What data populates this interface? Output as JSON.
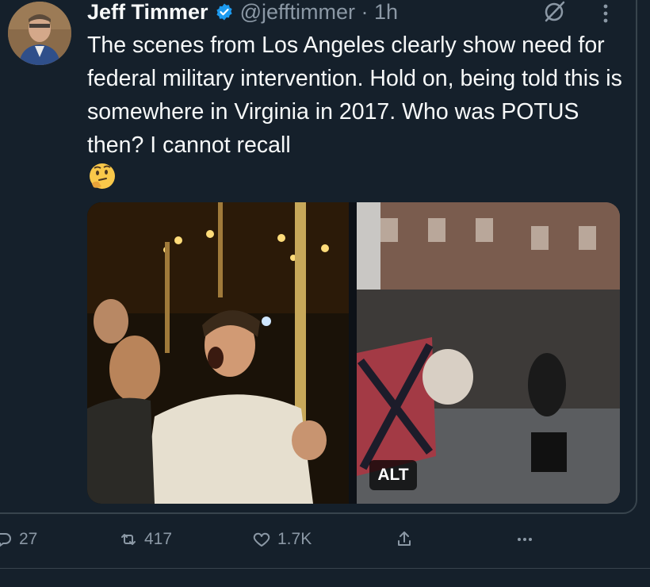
{
  "post": {
    "author_name": "Jeff Timmer",
    "handle_time": "@jefftimmer · 1h",
    "text": "The scenes from Los Angeles clearly show need for federal military intervention. Hold on, being told this is somewhere in Virginia in 2017. Who was POTUS then? I cannot recall",
    "emoji": "thinking-face",
    "media_badge": "ALT",
    "icons": {
      "verified": "verified-badge-icon",
      "grok": "grok-icon",
      "more": "more-options-icon"
    }
  },
  "actions": {
    "replies": "27",
    "reposts": "417",
    "likes": "1.7K",
    "share_icon": "share-icon",
    "more_icon": "more-horizontal-icon"
  },
  "colors": {
    "background": "#15202b",
    "text": "#f7f9f9",
    "secondary_text": "#8b98a5",
    "verified_blue": "#1d9bf0",
    "border": "#38444d"
  }
}
